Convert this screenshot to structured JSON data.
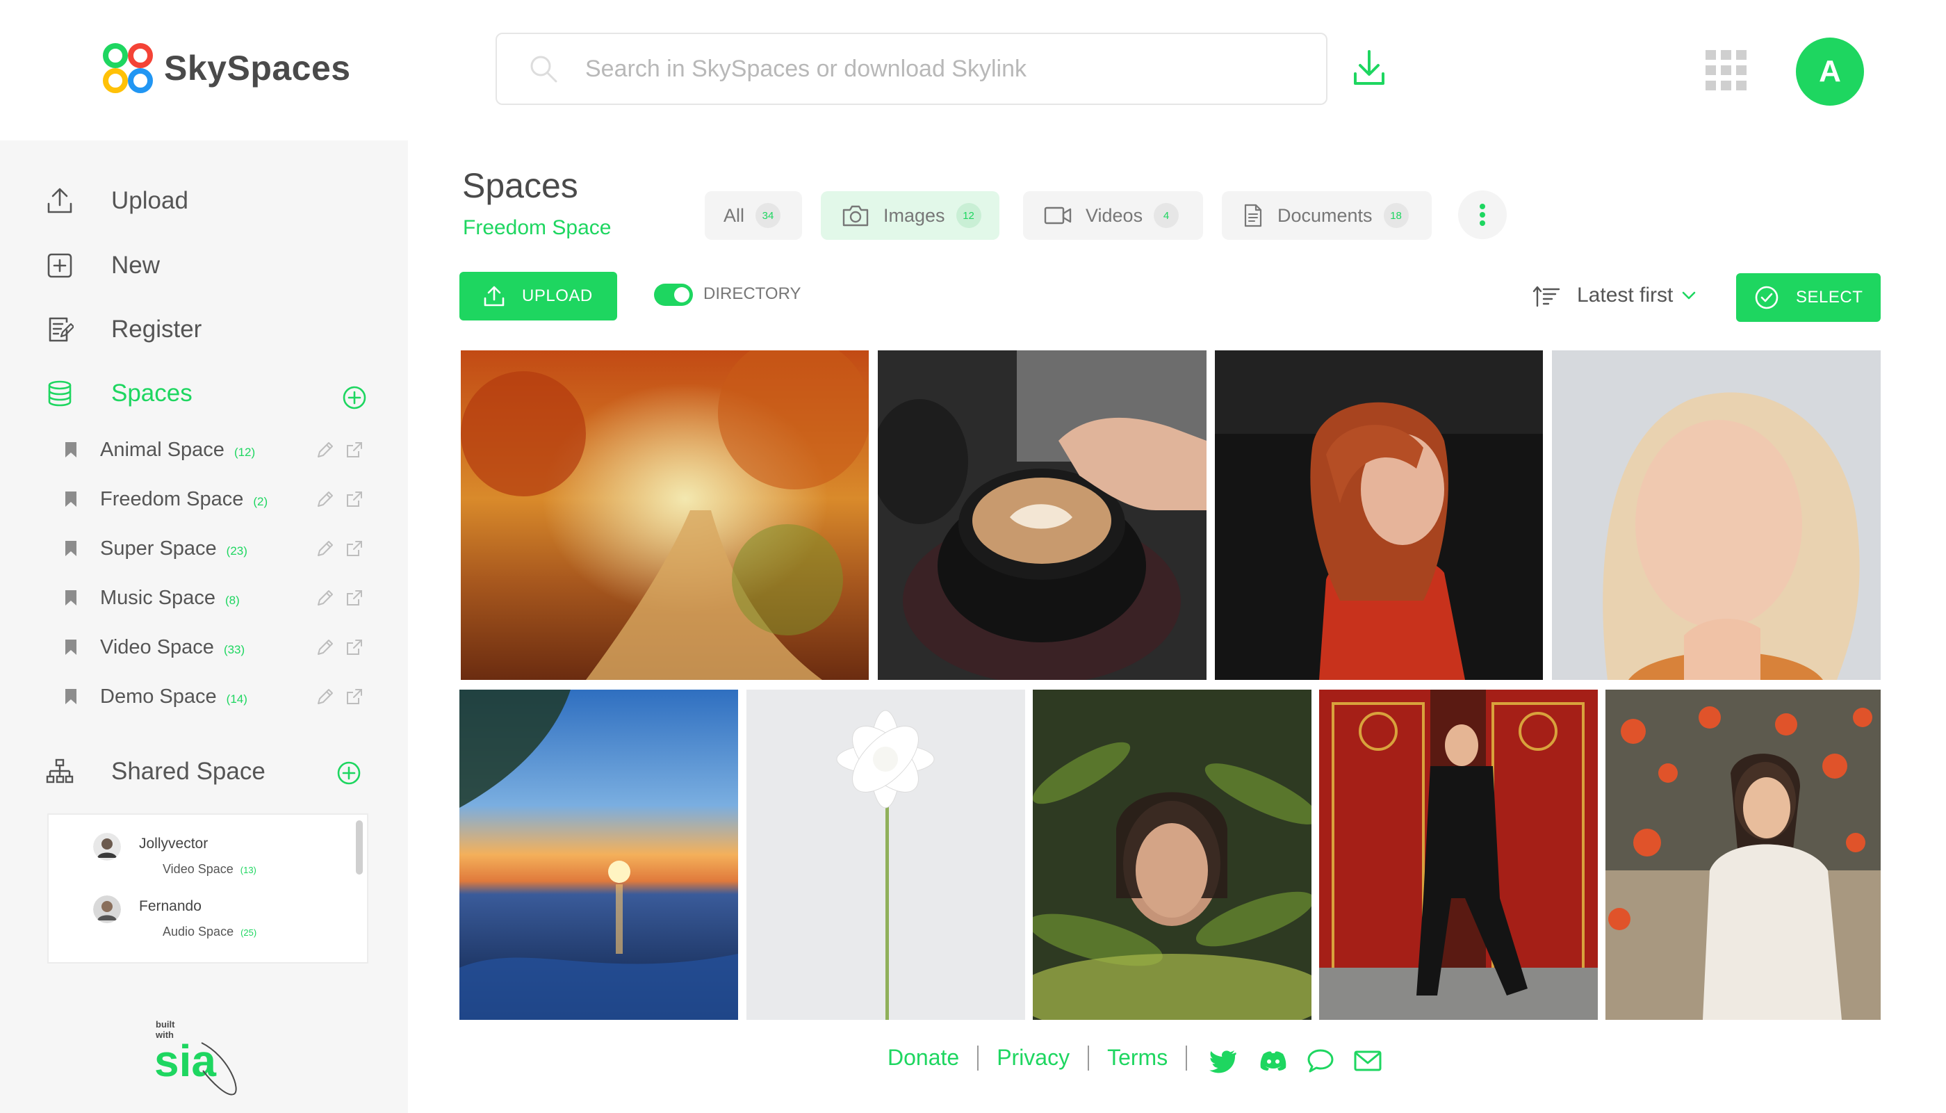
{
  "brand": {
    "name": "SkySpaces",
    "accent": "#1ed660",
    "logo_colors": [
      "#1ed660",
      "#f44336",
      "#ffc107",
      "#2196f3"
    ]
  },
  "header": {
    "search": {
      "placeholder": "Search in SkySpaces or download Skylink",
      "value": "",
      "icon": "search-icon"
    },
    "download_icon": "download-icon",
    "apps_icon": "apps-grid-icon",
    "avatar_initial": "A"
  },
  "sidebar": {
    "nav": [
      {
        "label": "Upload",
        "icon": "upload-icon"
      },
      {
        "label": "New",
        "icon": "plus-square-icon"
      },
      {
        "label": "Register",
        "icon": "register-icon"
      },
      {
        "label": "Spaces",
        "icon": "database-icon",
        "active": true
      }
    ],
    "spaces": [
      {
        "label": "Animal Space",
        "count": "(12)"
      },
      {
        "label": "Freedom Space",
        "count": "(2)"
      },
      {
        "label": "Super Space",
        "count": "(23)"
      },
      {
        "label": "Music Space",
        "count": "(8)"
      },
      {
        "label": "Video Space",
        "count": "(33)"
      },
      {
        "label": "Demo Space",
        "count": "(14)"
      }
    ],
    "shared": {
      "label": "Shared Space",
      "icon": "sitemap-icon",
      "users": [
        {
          "name": "Jollyvector",
          "space": "Video Space",
          "count": "(13)"
        },
        {
          "name": "Fernando",
          "space": "Audio Space",
          "count": "(25)"
        }
      ]
    },
    "badge": {
      "line1": "built",
      "line2": "with",
      "brand": "sia"
    }
  },
  "main": {
    "title": "Spaces",
    "subtitle": "Freedom Space",
    "tabs": [
      {
        "label": "All",
        "count": "34",
        "icon": ""
      },
      {
        "label": "Images",
        "count": "12",
        "icon": "camera-icon",
        "active": true
      },
      {
        "label": "Videos",
        "count": "4",
        "icon": "video-icon"
      },
      {
        "label": "Documents",
        "count": "18",
        "icon": "document-icon"
      }
    ],
    "more_icon": "more-vertical-icon",
    "upload_label": "UPLOAD",
    "directory": {
      "label": "DIRECTORY",
      "enabled": true
    },
    "sort_label": "Latest first",
    "select_label": "SELECT",
    "images": [
      "autumn forest path",
      "latte art coffee cup",
      "red-haired woman in red sweater",
      "blonde woman portrait",
      "sunset over lake",
      "white chrysanthemum flower",
      "woman among green leaves",
      "woman walking by red doors",
      "woman among red flowers"
    ]
  },
  "footer": {
    "links": [
      "Donate",
      "Privacy",
      "Terms"
    ],
    "social_icons": [
      "twitter-icon",
      "discord-icon",
      "chat-icon",
      "mail-icon"
    ]
  }
}
